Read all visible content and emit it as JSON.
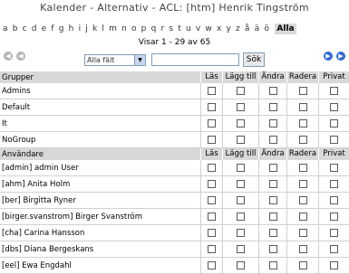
{
  "title": "Kalender - Alternativ - ACL: [htm] Henrik Tingström",
  "letters": [
    "a",
    "b",
    "c",
    "d",
    "e",
    "f",
    "g",
    "h",
    "i",
    "j",
    "k",
    "l",
    "m",
    "n",
    "o",
    "p",
    "q",
    "r",
    "s",
    "t",
    "u",
    "v",
    "w",
    "x",
    "y",
    "z",
    "å",
    "ä",
    "ö"
  ],
  "all_label": "Alla",
  "showing": "Visar 1 - 29 av 65",
  "filter": {
    "selected": "Alla fält"
  },
  "search_button": "Sök",
  "columns": [
    "Läs",
    "Lägg till",
    "Ändra",
    "Radera",
    "Privat"
  ],
  "groups": {
    "header": "Grupper",
    "items": [
      "Admins",
      "Default",
      "It",
      "NoGroup"
    ]
  },
  "users": {
    "header": "Användare",
    "items": [
      "[admin] admin User",
      "[ahm] Anita Holm",
      "[ber] Birgitta Ryner",
      "[birger.svanstrom] Birger Svanström",
      "[cha] Carina Hansson",
      "[dbs] Diana Bergeskans",
      "[eel] Ewa Engdahl"
    ]
  }
}
